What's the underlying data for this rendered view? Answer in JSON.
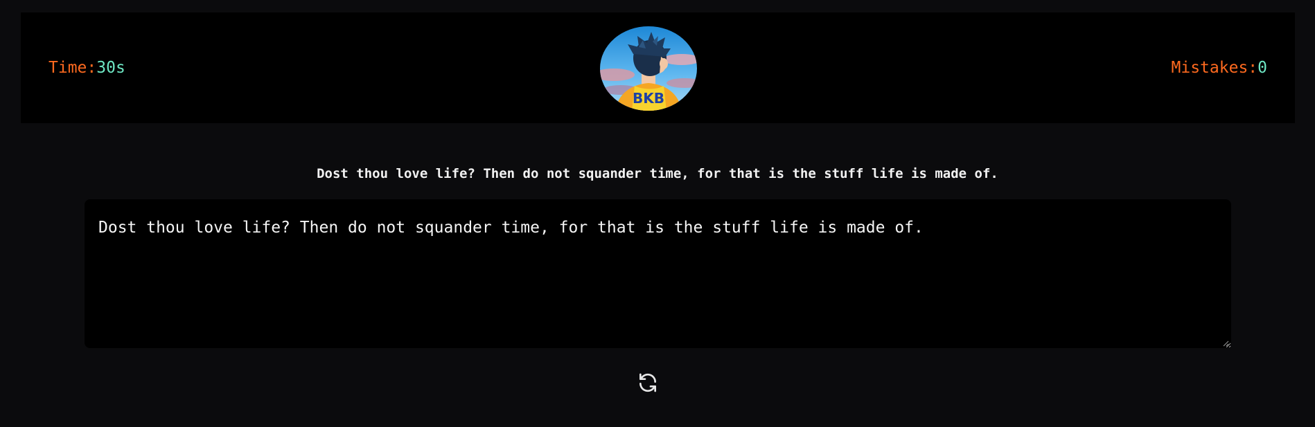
{
  "header": {
    "time_label": "Time: ",
    "time_value": "30s",
    "mistakes_label": "Mistakes: ",
    "mistakes_value": "0",
    "avatar_text": "BKB",
    "avatar_icon": "anime-boy-avatar"
  },
  "quote": {
    "text": "Dost thou love life? Then do not squander time, for that is the stuff life is made of."
  },
  "input": {
    "value": "Dost thou love life? Then do not squander time, for that is the stuff life is made of."
  },
  "controls": {
    "restart_icon": "refresh-icon"
  },
  "colors": {
    "label_accent": "#ff6a1f",
    "value_accent": "#6ee7c4",
    "page_bg": "#0b0b0d",
    "panel_bg": "#000000"
  }
}
